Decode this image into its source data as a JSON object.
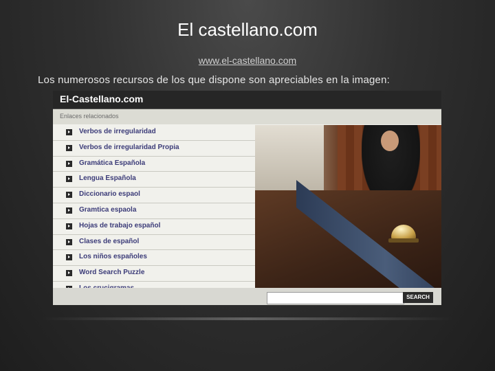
{
  "slide": {
    "title": "El castellano.com",
    "link": "www.el-castellano.com",
    "caption": "Los numerosos recursos de los que dispone son apreciables en la imagen:"
  },
  "site": {
    "logo": "El-Castellano.com",
    "section_title": "Enlaces relacionados",
    "links": [
      {
        "label": "Verbos de irregularidad"
      },
      {
        "label": "Verbos de irregularidad Propia"
      },
      {
        "label": "Gramática Española"
      },
      {
        "label": "Lengua Española"
      },
      {
        "label": "Diccionario espaol"
      },
      {
        "label": "Gramtica espaola"
      },
      {
        "label": "Hojas de trabajo español"
      },
      {
        "label": "Clases de español"
      },
      {
        "label": "Los niños españoles"
      },
      {
        "label": "Word Search Puzzle"
      },
      {
        "label": "Los crucigramas"
      }
    ],
    "search_placeholder": "",
    "search_button": "SEARCH"
  }
}
